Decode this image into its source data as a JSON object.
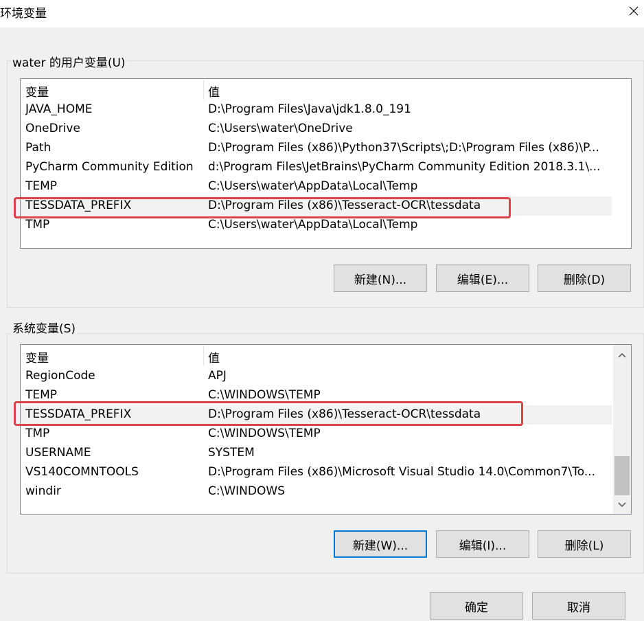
{
  "window": {
    "title": "环境变量"
  },
  "user_section": {
    "label": "water 的用户变量(U)",
    "columns": {
      "name": "变量",
      "value": "值"
    },
    "rows": [
      {
        "name": "JAVA_HOME",
        "value": "D:\\Program Files\\Java\\jdk1.8.0_191"
      },
      {
        "name": "OneDrive",
        "value": "C:\\Users\\water\\OneDrive"
      },
      {
        "name": "Path",
        "value": "D:\\Program Files (x86)\\Python37\\Scripts\\;D:\\Program Files (x86)\\P..."
      },
      {
        "name": "PyCharm Community Edition",
        "value": "d:\\Program Files\\JetBrains\\PyCharm Community Edition 2018.3.1\\..."
      },
      {
        "name": "TEMP",
        "value": "C:\\Users\\water\\AppData\\Local\\Temp"
      },
      {
        "name": "TESSDATA_PREFIX",
        "value": "D:\\Program Files (x86)\\Tesseract-OCR\\tessdata"
      },
      {
        "name": "TMP",
        "value": "C:\\Users\\water\\AppData\\Local\\Temp"
      }
    ],
    "buttons": {
      "new": "新建(N)...",
      "edit": "编辑(E)...",
      "delete": "删除(D)"
    }
  },
  "system_section": {
    "label": "系统变量(S)",
    "columns": {
      "name": "变量",
      "value": "值"
    },
    "rows": [
      {
        "name": "RegionCode",
        "value": "APJ"
      },
      {
        "name": "TEMP",
        "value": "C:\\WINDOWS\\TEMP"
      },
      {
        "name": "TESSDATA_PREFIX",
        "value": "D:\\Program Files (x86)\\Tesseract-OCR\\tessdata"
      },
      {
        "name": "TMP",
        "value": "C:\\WINDOWS\\TEMP"
      },
      {
        "name": "USERNAME",
        "value": "SYSTEM"
      },
      {
        "name": "VS140COMNTOOLS",
        "value": "D:\\Program Files (x86)\\Microsoft Visual Studio 14.0\\Common7\\To..."
      },
      {
        "name": "windir",
        "value": "C:\\WINDOWS"
      }
    ],
    "buttons": {
      "new": "新建(W)...",
      "edit": "编辑(I)...",
      "delete": "删除(L)"
    }
  },
  "footer": {
    "ok": "确定",
    "cancel": "取消"
  },
  "icons": {
    "close": "close-icon",
    "scroll_up": "chevron-up-icon",
    "scroll_down": "chevron-down-icon"
  },
  "colors": {
    "highlight": "#d9454a",
    "focus": "#0078d7",
    "selected_row": "#f2f2f2"
  }
}
